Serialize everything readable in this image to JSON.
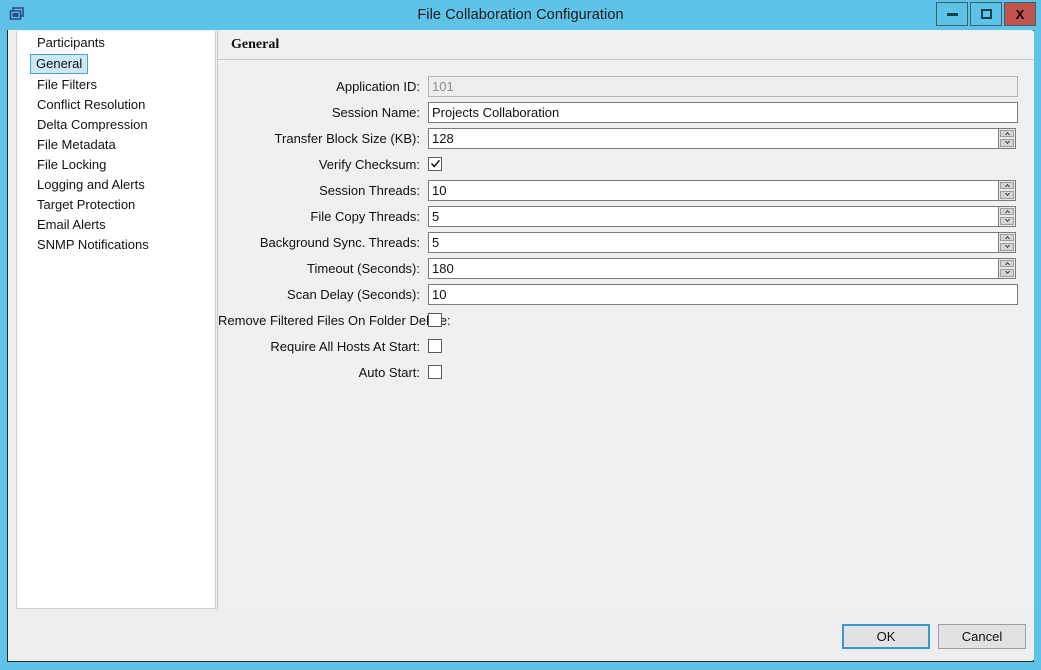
{
  "window": {
    "title": "File Collaboration Configuration",
    "icon": "windows-overlap-icon",
    "accent_color": "#5fc3e8",
    "close_color": "#c1554e",
    "controls": [
      {
        "name": "minimize-button",
        "label": ""
      },
      {
        "name": "maximize-button",
        "label": ""
      },
      {
        "name": "close-button",
        "label": "X"
      }
    ]
  },
  "sidebar": {
    "selected": "General",
    "items": [
      {
        "label": "Participants"
      },
      {
        "label": "General"
      },
      {
        "label": "File Filters"
      },
      {
        "label": "Conflict Resolution"
      },
      {
        "label": "Delta Compression"
      },
      {
        "label": "File Metadata"
      },
      {
        "label": "File Locking"
      },
      {
        "label": "Logging and Alerts"
      },
      {
        "label": "Target Protection"
      },
      {
        "label": "Email Alerts"
      },
      {
        "label": "SNMP Notifications"
      }
    ]
  },
  "content": {
    "header": "General",
    "fields": [
      {
        "label": "Application ID:",
        "value": "101",
        "type": "text-disabled"
      },
      {
        "label": "Session Name:",
        "value": "Projects Collaboration",
        "type": "text"
      },
      {
        "label": "Transfer Block Size (KB):",
        "value": "128",
        "type": "spinner"
      },
      {
        "label": "Verify Checksum:",
        "value": "",
        "type": "checkbox",
        "checked": true
      },
      {
        "label": "Session Threads:",
        "value": "10",
        "type": "spinner"
      },
      {
        "label": "File Copy Threads:",
        "value": "5",
        "type": "spinner"
      },
      {
        "label": "Background Sync. Threads:",
        "value": "5",
        "type": "spinner"
      },
      {
        "label": "Timeout (Seconds):",
        "value": "180",
        "type": "spinner"
      },
      {
        "label": "Scan Delay (Seconds):",
        "value": "10",
        "type": "text"
      },
      {
        "label": "Remove Filtered Files On Folder Delete:",
        "value": "",
        "type": "checkbox",
        "checked": false
      },
      {
        "label": "Require All Hosts At Start:",
        "value": "",
        "type": "checkbox",
        "checked": false
      },
      {
        "label": "Auto Start:",
        "value": "",
        "type": "checkbox",
        "checked": false
      }
    ]
  },
  "footer": {
    "ok_label": "OK",
    "cancel_label": "Cancel"
  }
}
